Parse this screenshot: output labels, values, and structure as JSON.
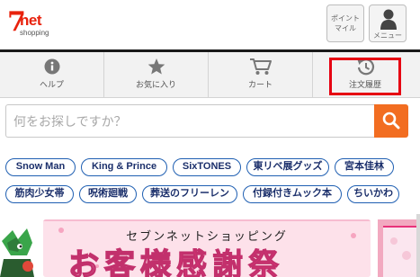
{
  "header": {
    "logo": {
      "seven": "7",
      "net": "net",
      "sub": "shopping"
    },
    "point_button": {
      "label": "ポイント\nマイル"
    },
    "menu_button": {
      "label": "メニュー",
      "icon": "user-icon"
    }
  },
  "nav": {
    "items": [
      {
        "label": "ヘルプ",
        "icon": "info-icon"
      },
      {
        "label": "お気に入り",
        "icon": "star-icon"
      },
      {
        "label": "カート",
        "icon": "cart-icon"
      },
      {
        "label": "注文履歴",
        "icon": "history-icon",
        "highlighted": true
      }
    ],
    "highlight_color": "#e60012"
  },
  "search": {
    "placeholder": "何をお探しですか？",
    "button_color": "#f26d21",
    "icon": "search-icon"
  },
  "tags": [
    "Snow Man",
    "King & Prince",
    "SixTONES",
    "東リベ展グッズ",
    "宮本佳林",
    "筋肉少女帯",
    "呪術廻戦",
    "葬送のフリーレン",
    "付録付きムック本",
    "ちいかわ"
  ],
  "banner": {
    "subtitle": "セブンネットショッピング",
    "title_a": "お客様",
    "title_b": "感謝祭",
    "bg_color": "#fde1ea",
    "accent_color": "#e8327a"
  }
}
